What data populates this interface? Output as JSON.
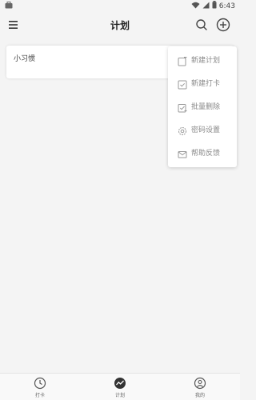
{
  "status_bar": {
    "time": "6:43",
    "icons": [
      "briefcase-icon",
      "wifi-icon",
      "signal-icon",
      "battery-icon"
    ]
  },
  "header": {
    "title": "计划",
    "icons": [
      "menu-icon",
      "search-icon",
      "add-circle-icon"
    ]
  },
  "habits": [
    {
      "label": "小习惯"
    }
  ],
  "dropdown": {
    "items": [
      {
        "label": "新建计划",
        "icon": "new-plan-icon"
      },
      {
        "label": "新建打卡",
        "icon": "new-checkin-icon"
      },
      {
        "label": "批量删除",
        "icon": "batch-delete-icon"
      },
      {
        "label": "密码设置",
        "icon": "settings-icon"
      },
      {
        "label": "帮助反馈",
        "icon": "mail-icon"
      }
    ]
  },
  "bottom_nav": {
    "items": [
      {
        "label": "打卡",
        "icon": "clock-icon"
      },
      {
        "label": "计划",
        "icon": "trend-icon"
      },
      {
        "label": "我的",
        "icon": "user-icon"
      }
    ]
  },
  "colors": {
    "background": "#f4f4f4",
    "card": "#ffffff",
    "menu_text": "#888888",
    "title_text": "#222222"
  }
}
